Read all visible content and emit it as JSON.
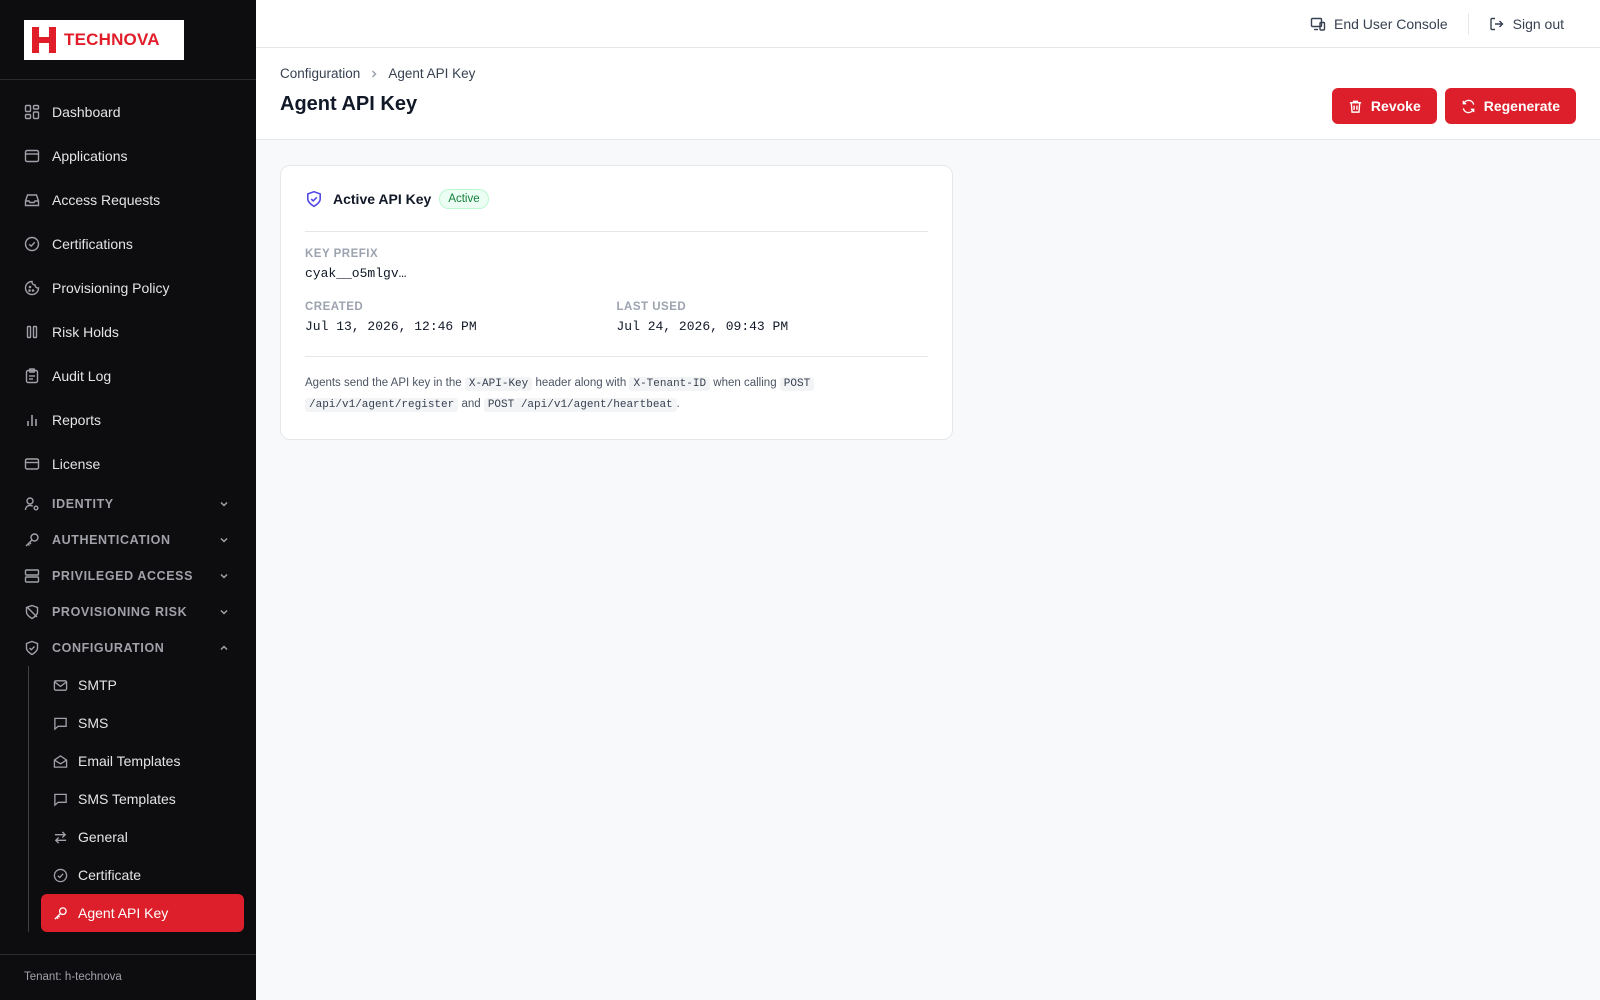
{
  "brand": {
    "name": "TECHNOVA",
    "accent": "#dc1f2a"
  },
  "sidebar": {
    "items": [
      {
        "label": "Dashboard",
        "icon": "dashboard-icon"
      },
      {
        "label": "Applications",
        "icon": "window-icon"
      },
      {
        "label": "Access Requests",
        "icon": "inbox-icon"
      },
      {
        "label": "Certifications",
        "icon": "check-circle-icon"
      },
      {
        "label": "Provisioning Policy",
        "icon": "cookie-icon"
      },
      {
        "label": "Risk Holds",
        "icon": "pause-icon"
      },
      {
        "label": "Audit Log",
        "icon": "clipboard-icon"
      },
      {
        "label": "Reports",
        "icon": "bar-chart-icon"
      },
      {
        "label": "License",
        "icon": "card-icon"
      }
    ],
    "sections": [
      {
        "label": "IDENTITY",
        "expanded": false
      },
      {
        "label": "AUTHENTICATION",
        "expanded": false
      },
      {
        "label": "PRIVILEGED ACCESS",
        "expanded": false
      },
      {
        "label": "PROVISIONING RISK",
        "expanded": false
      },
      {
        "label": "CONFIGURATION",
        "expanded": true
      }
    ],
    "config_items": [
      {
        "label": "SMTP"
      },
      {
        "label": "SMS"
      },
      {
        "label": "Email Templates"
      },
      {
        "label": "SMS Templates"
      },
      {
        "label": "General"
      },
      {
        "label": "Certificate"
      },
      {
        "label": "Agent API Key",
        "active": true
      }
    ],
    "tenant": "Tenant: h-technova"
  },
  "topbar": {
    "end_user_console": "End User Console",
    "sign_out": "Sign out"
  },
  "header": {
    "breadcrumb": [
      "Configuration",
      "Agent API Key"
    ],
    "title": "Agent API Key",
    "revoke_label": "Revoke",
    "regenerate_label": "Regenerate"
  },
  "card": {
    "title": "Active API Key",
    "status": "Active",
    "key_prefix_label": "KEY PREFIX",
    "key_prefix": "cyak__o5mlgv…",
    "created_label": "CREATED",
    "created": "Jul 13, 2026, 12:46 PM",
    "last_used_label": "LAST USED",
    "last_used": "Jul 24, 2026, 09:43 PM",
    "note": {
      "t1": "Agents send the API key in the",
      "c1": "X-API-Key",
      "t2": "header along with",
      "c2": "X-Tenant-ID",
      "t3": "when calling",
      "c3a": "POST",
      "c3b": "/api/v1/agent/register",
      "t4": "and",
      "c4": "POST /api/v1/agent/heartbeat",
      "t5": "."
    }
  }
}
